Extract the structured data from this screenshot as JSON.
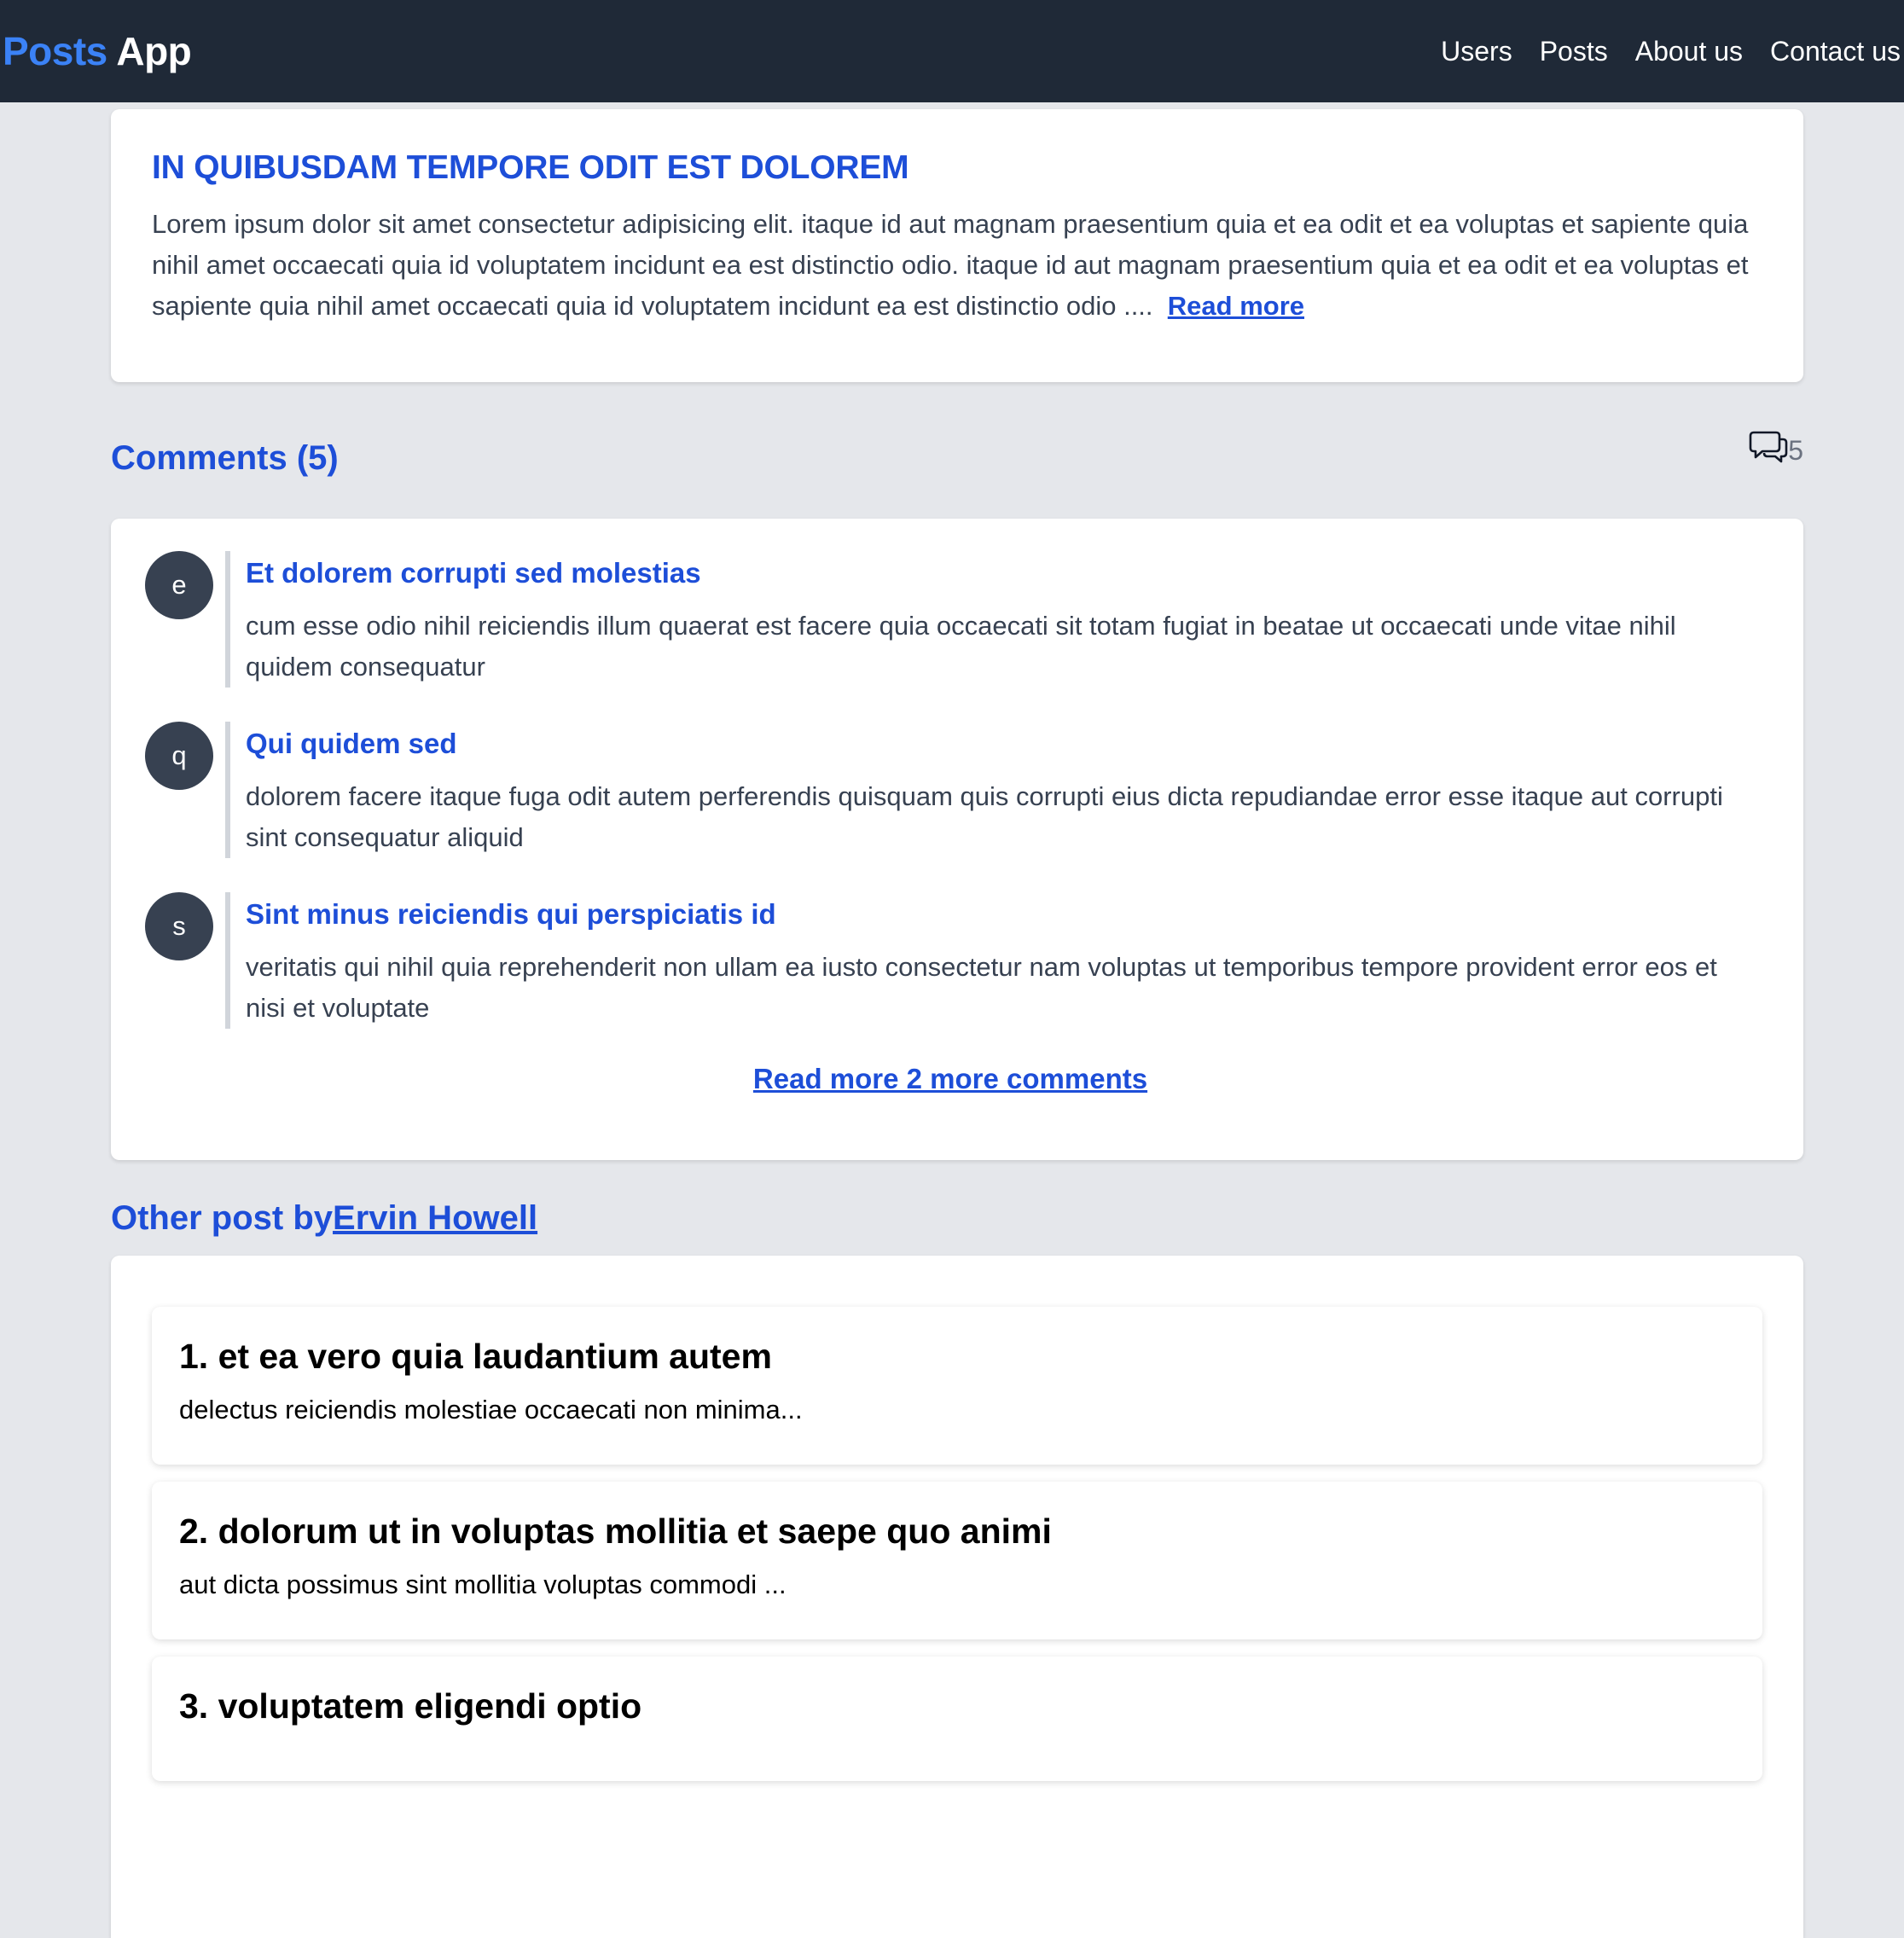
{
  "navbar": {
    "brand_part1": "Posts",
    "brand_part2": "App",
    "links": [
      "Users",
      "Posts",
      "About us",
      "Contact us"
    ]
  },
  "post": {
    "title": "IN QUIBUSDAM TEMPORE ODIT EST DOLOREM",
    "body": "Lorem ipsum dolor sit amet consectetur adipisicing elit. itaque id aut magnam praesentium quia et ea odit et ea voluptas et sapiente quia nihil amet occaecati quia id voluptatem incidunt ea est distinctio odio. itaque id aut magnam praesentium quia et ea odit et ea voluptas et sapiente quia nihil amet occaecati quia id voluptatem incidunt ea est distinctio odio ....",
    "read_more": "Read more"
  },
  "comments": {
    "title": "Comments (5)",
    "count": "5",
    "items": [
      {
        "avatar": "e",
        "name": "Et dolorem corrupti sed molestias",
        "body": "cum esse odio nihil reiciendis illum quaerat est facere quia occaecati sit totam fugiat in beatae ut occaecati unde vitae nihil quidem consequatur"
      },
      {
        "avatar": "q",
        "name": "Qui quidem sed",
        "body": "dolorem facere itaque fuga odit autem perferendis quisquam quis corrupti eius dicta repudiandae error esse itaque aut corrupti sint consequatur aliquid"
      },
      {
        "avatar": "s",
        "name": "Sint minus reiciendis qui perspiciatis id",
        "body": "veritatis qui nihil quia reprehenderit non ullam ea iusto consectetur nam voluptas ut temporibus tempore provident error eos et nisi et voluptate"
      }
    ],
    "more_link": "Read more 2 more comments"
  },
  "other_posts": {
    "heading_prefix": "Other post by",
    "author": "Ervin Howell",
    "items": [
      {
        "title": "1. et ea vero quia laudantium autem",
        "body": "delectus reiciendis molestiae occaecati non minima..."
      },
      {
        "title": "2. dolorum ut in voluptas mollitia et saepe quo animi",
        "body": "aut dicta possimus sint mollitia voluptas commodi ..."
      },
      {
        "title": "3. voluptatem eligendi optio",
        "body": ""
      }
    ]
  },
  "colors": {
    "navbar_bg": "#1f2937",
    "brand_accent": "#3b82f6",
    "link_blue": "#1d4ed8",
    "page_bg": "#e5e7eb",
    "avatar_bg": "#374151"
  },
  "icons": {
    "comment_counter": "chat-bubbles-icon"
  }
}
